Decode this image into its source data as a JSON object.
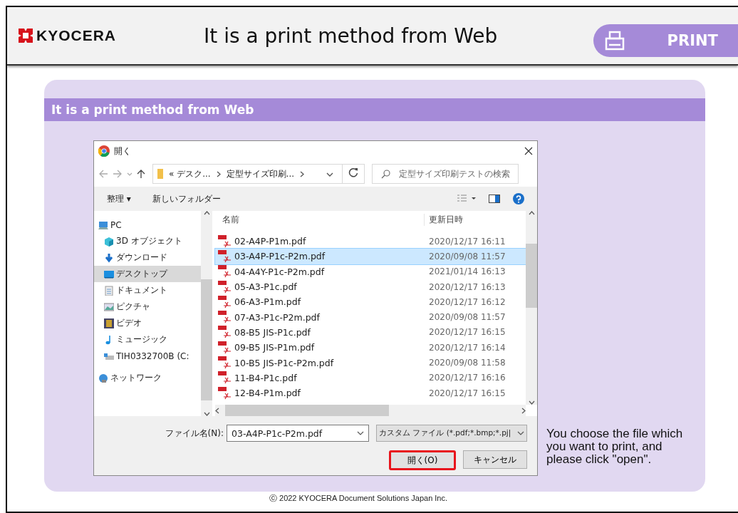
{
  "header": {
    "logo": "KYOCERA",
    "title": "It is a print method from Web",
    "tab": {
      "label": "PRINT"
    }
  },
  "panel": {
    "title": "It is a print method from Web",
    "dialog": {
      "title": "開く",
      "address": {
        "crumbs": [
          "« デスク...",
          "定型サイズ印刷..."
        ]
      },
      "search": {
        "placeholder": "定型サイズ印刷テストの検索"
      },
      "toolbar": {
        "organize": "整理 ▾",
        "new_folder": "新しいフォルダー"
      },
      "sidebar": {
        "items": [
          {
            "label": "PC",
            "selected": false,
            "children": [
              {
                "label": "3D オブジェクト",
                "selected": false
              },
              {
                "label": "ダウンロード",
                "selected": false
              },
              {
                "label": "デスクトップ",
                "selected": true
              },
              {
                "label": "ドキュメント",
                "selected": false
              },
              {
                "label": "ピクチャ",
                "selected": false
              },
              {
                "label": "ビデオ",
                "selected": false
              },
              {
                "label": "ミュージック",
                "selected": false
              },
              {
                "label": "TIH0332700B (C:",
                "selected": false
              }
            ]
          },
          {
            "label": "ネットワーク",
            "selected": false
          }
        ]
      },
      "files": {
        "columns": [
          "名前",
          "更新日時"
        ],
        "rows": [
          {
            "name": "02-A4P-P1m.pdf",
            "date": "2020/12/17 16:11",
            "selected": false
          },
          {
            "name": "03-A4P-P1c-P2m.pdf",
            "date": "2020/09/08 11:57",
            "selected": true
          },
          {
            "name": "04-A4Y-P1c-P2m.pdf",
            "date": "2021/01/14 16:13",
            "selected": false
          },
          {
            "name": "05-A3-P1c.pdf",
            "date": "2020/12/17 16:13",
            "selected": false
          },
          {
            "name": "06-A3-P1m.pdf",
            "date": "2020/12/17 16:12",
            "selected": false
          },
          {
            "name": "07-A3-P1c-P2m.pdf",
            "date": "2020/09/08 11:57",
            "selected": false
          },
          {
            "name": "08-B5 JIS-P1c.pdf",
            "date": "2020/12/17 16:15",
            "selected": false
          },
          {
            "name": "09-B5 JIS-P1m.pdf",
            "date": "2020/12/17 16:14",
            "selected": false
          },
          {
            "name": "10-B5 JIS-P1c-P2m.pdf",
            "date": "2020/09/08 11:58",
            "selected": false
          },
          {
            "name": "11-B4-P1c.pdf",
            "date": "2020/12/17 16:16",
            "selected": false
          },
          {
            "name": "12-B4-P1m.pdf",
            "date": "2020/12/17 16:15",
            "selected": false
          }
        ]
      },
      "filename_label": "ファイル名(N):",
      "filename": "03-A4P-P1c-P2m.pdf",
      "filter": "カスタム ファイル (*.pdf;*.bmp;*.pj|",
      "buttons": [
        {
          "label": "開く(O)",
          "highlighted": true
        },
        {
          "label": "キャンセル",
          "highlighted": false
        }
      ]
    },
    "instruction": "You choose the file which you want to print, and please click \"open\"."
  },
  "footer": "ⓒ 2022 KYOCERA Document Solutions Japan Inc."
}
